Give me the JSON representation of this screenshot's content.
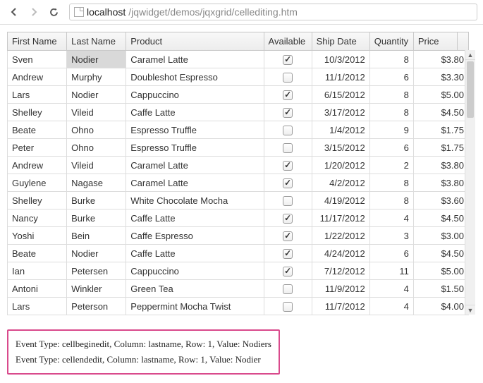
{
  "url": {
    "host": "localhost",
    "path": "/jqwidget/demos/jqxgrid/cellediting.htm"
  },
  "headers": {
    "first_name": "First Name",
    "last_name": "Last Name",
    "product": "Product",
    "available": "Available",
    "ship_date": "Ship Date",
    "quantity": "Quantity",
    "price": "Price"
  },
  "rows": [
    {
      "first": "Sven",
      "last": "Nodier",
      "product": "Caramel Latte",
      "avail": true,
      "ship": "10/3/2012",
      "qty": "8",
      "price": "$3.80",
      "editing": true
    },
    {
      "first": "Andrew",
      "last": "Murphy",
      "product": "Doubleshot Espresso",
      "avail": false,
      "ship": "11/1/2012",
      "qty": "6",
      "price": "$3.30"
    },
    {
      "first": "Lars",
      "last": "Nodier",
      "product": "Cappuccino",
      "avail": true,
      "ship": "6/15/2012",
      "qty": "8",
      "price": "$5.00"
    },
    {
      "first": "Shelley",
      "last": "Vileid",
      "product": "Caffe Latte",
      "avail": true,
      "ship": "3/17/2012",
      "qty": "8",
      "price": "$4.50"
    },
    {
      "first": "Beate",
      "last": "Ohno",
      "product": "Espresso Truffle",
      "avail": false,
      "ship": "1/4/2012",
      "qty": "9",
      "price": "$1.75"
    },
    {
      "first": "Peter",
      "last": "Ohno",
      "product": "Espresso Truffle",
      "avail": false,
      "ship": "3/15/2012",
      "qty": "6",
      "price": "$1.75"
    },
    {
      "first": "Andrew",
      "last": "Vileid",
      "product": "Caramel Latte",
      "avail": true,
      "ship": "1/20/2012",
      "qty": "2",
      "price": "$3.80"
    },
    {
      "first": "Guylene",
      "last": "Nagase",
      "product": "Caramel Latte",
      "avail": true,
      "ship": "4/2/2012",
      "qty": "8",
      "price": "$3.80"
    },
    {
      "first": "Shelley",
      "last": "Burke",
      "product": "White Chocolate Mocha",
      "avail": false,
      "ship": "4/19/2012",
      "qty": "8",
      "price": "$3.60"
    },
    {
      "first": "Nancy",
      "last": "Burke",
      "product": "Caffe Latte",
      "avail": true,
      "ship": "11/17/2012",
      "qty": "4",
      "price": "$4.50"
    },
    {
      "first": "Yoshi",
      "last": "Bein",
      "product": "Caffe Espresso",
      "avail": true,
      "ship": "1/22/2012",
      "qty": "3",
      "price": "$3.00"
    },
    {
      "first": "Beate",
      "last": "Nodier",
      "product": "Caffe Latte",
      "avail": true,
      "ship": "4/24/2012",
      "qty": "6",
      "price": "$4.50"
    },
    {
      "first": "Ian",
      "last": "Petersen",
      "product": "Cappuccino",
      "avail": true,
      "ship": "7/12/2012",
      "qty": "11",
      "price": "$5.00"
    },
    {
      "first": "Antoni",
      "last": "Winkler",
      "product": "Green Tea",
      "avail": false,
      "ship": "11/9/2012",
      "qty": "4",
      "price": "$1.50"
    },
    {
      "first": "Lars",
      "last": "Peterson",
      "product": "Peppermint Mocha Twist",
      "avail": false,
      "ship": "11/7/2012",
      "qty": "4",
      "price": "$4.00"
    }
  ],
  "events": {
    "line1": "Event Type: cellbeginedit, Column: lastname, Row: 1, Value: Nodiers",
    "line2": "Event Type: cellendedit, Column: lastname, Row: 1, Value: Nodier"
  }
}
